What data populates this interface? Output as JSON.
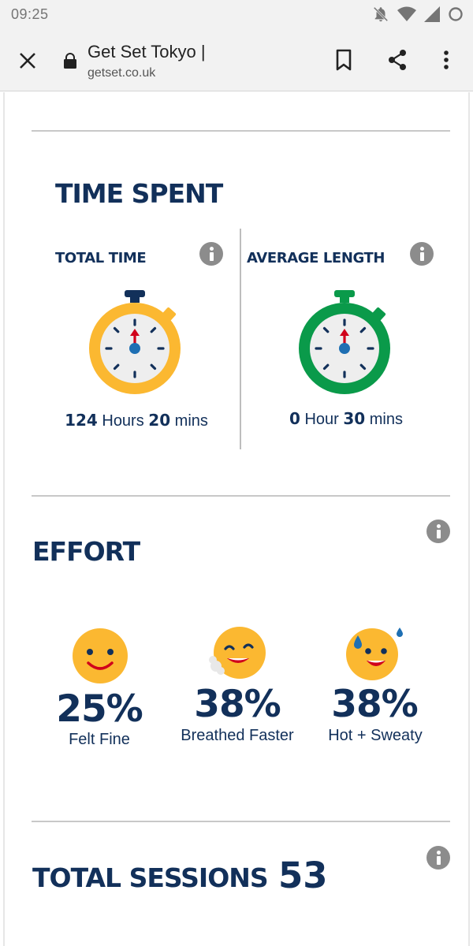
{
  "status_bar": {
    "time": "09:25",
    "icons": [
      "bell-off-icon",
      "wifi-icon",
      "signal-icon",
      "circle-icon"
    ]
  },
  "browser": {
    "title": "Get Set Tokyo |",
    "url": "getset.co.uk",
    "icons": [
      "close-icon",
      "lock-icon",
      "bookmark-icon",
      "share-icon",
      "more-vert-icon"
    ]
  },
  "time_spent": {
    "title": "TIME SPENT",
    "total": {
      "label": "TOTAL TIME",
      "hours": "124",
      "hours_unit": " Hours ",
      "mins": "20",
      "mins_unit": " mins",
      "color": "#FBB831"
    },
    "average": {
      "label": "AVERAGE LENGTH",
      "hours": "0",
      "hours_unit": " Hour ",
      "mins": "30",
      "mins_unit": " mins",
      "color": "#0A9A4A"
    }
  },
  "effort": {
    "title": "EFFORT",
    "items": [
      {
        "percent": "25%",
        "label": "Felt Fine"
      },
      {
        "percent": "38%",
        "label": "Breathed Faster"
      },
      {
        "percent": "38%",
        "label": "Hot + Sweaty"
      }
    ],
    "face_color": "#FBB831"
  },
  "sessions": {
    "title": "TOTAL SESSIONS",
    "count": "53"
  },
  "colors": {
    "navy": "#12305A",
    "info_grey": "#8C8C8C",
    "red_hand": "#D0021B",
    "blue_pivot": "#1E6FB3"
  }
}
